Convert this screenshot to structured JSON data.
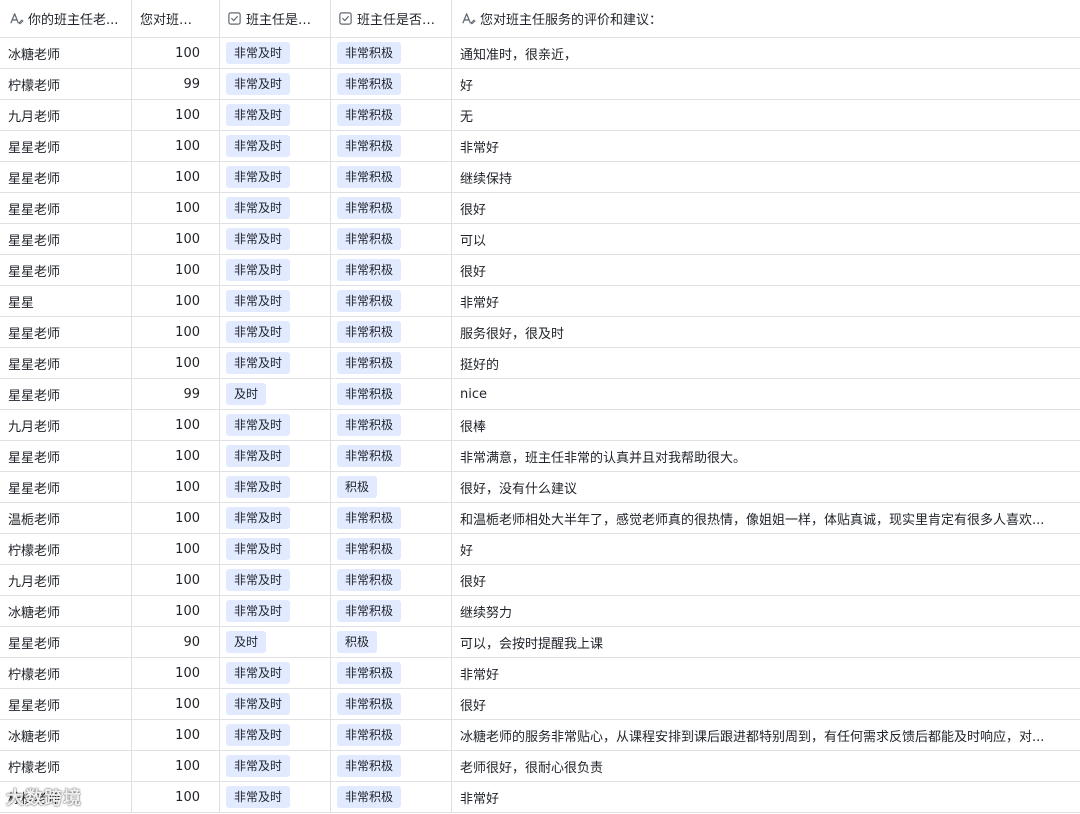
{
  "columns": [
    {
      "label": "你的班主任老...",
      "icon": "text-field-icon"
    },
    {
      "label": "您对班主...",
      "icon": ""
    },
    {
      "label": "班主任是否...",
      "icon": "select-field-icon"
    },
    {
      "label": "班主任是否积...",
      "icon": "select-field-icon"
    },
    {
      "label": "您对班主任服务的评价和建议：",
      "icon": "text-field-icon"
    }
  ],
  "rows": [
    {
      "teacher": "冰糖老师",
      "score": "100",
      "timely": "非常及时",
      "active": "非常积极",
      "comment": "通知准时，很亲近，"
    },
    {
      "teacher": "柠檬老师",
      "score": "99",
      "timely": "非常及时",
      "active": "非常积极",
      "comment": "好"
    },
    {
      "teacher": "九月老师",
      "score": "100",
      "timely": "非常及时",
      "active": "非常积极",
      "comment": "无"
    },
    {
      "teacher": "星星老师",
      "score": "100",
      "timely": "非常及时",
      "active": "非常积极",
      "comment": "非常好"
    },
    {
      "teacher": "星星老师",
      "score": "100",
      "timely": "非常及时",
      "active": "非常积极",
      "comment": "继续保持"
    },
    {
      "teacher": "星星老师",
      "score": "100",
      "timely": "非常及时",
      "active": "非常积极",
      "comment": "很好"
    },
    {
      "teacher": "星星老师",
      "score": "100",
      "timely": "非常及时",
      "active": "非常积极",
      "comment": "可以"
    },
    {
      "teacher": "星星老师",
      "score": "100",
      "timely": "非常及时",
      "active": "非常积极",
      "comment": "很好"
    },
    {
      "teacher": "星星",
      "score": "100",
      "timely": "非常及时",
      "active": "非常积极",
      "comment": "非常好"
    },
    {
      "teacher": "星星老师",
      "score": "100",
      "timely": "非常及时",
      "active": "非常积极",
      "comment": "服务很好，很及时"
    },
    {
      "teacher": "星星老师",
      "score": "100",
      "timely": "非常及时",
      "active": "非常积极",
      "comment": "挺好的"
    },
    {
      "teacher": "星星老师",
      "score": "99",
      "timely": "及时",
      "active": "非常积极",
      "comment": "nice"
    },
    {
      "teacher": "九月老师",
      "score": "100",
      "timely": "非常及时",
      "active": "非常积极",
      "comment": "很棒"
    },
    {
      "teacher": "星星老师",
      "score": "100",
      "timely": "非常及时",
      "active": "非常积极",
      "comment": "非常满意，班主任非常的认真并且对我帮助很大。"
    },
    {
      "teacher": "星星老师",
      "score": "100",
      "timely": "非常及时",
      "active": "积极",
      "comment": "很好，没有什么建议"
    },
    {
      "teacher": "温栀老师",
      "score": "100",
      "timely": "非常及时",
      "active": "非常积极",
      "comment": "和温栀老师相处大半年了，感觉老师真的很热情，像姐姐一样，体贴真诚，现实里肯定有很多人喜欢..."
    },
    {
      "teacher": "柠檬老师",
      "score": "100",
      "timely": "非常及时",
      "active": "非常积极",
      "comment": "好"
    },
    {
      "teacher": "九月老师",
      "score": "100",
      "timely": "非常及时",
      "active": "非常积极",
      "comment": "很好"
    },
    {
      "teacher": "冰糖老师",
      "score": "100",
      "timely": "非常及时",
      "active": "非常积极",
      "comment": "继续努力"
    },
    {
      "teacher": "星星老师",
      "score": "90",
      "timely": "及时",
      "active": "积极",
      "comment": "可以，会按时提醒我上课"
    },
    {
      "teacher": "柠檬老师",
      "score": "100",
      "timely": "非常及时",
      "active": "非常积极",
      "comment": "非常好"
    },
    {
      "teacher": "星星老师",
      "score": "100",
      "timely": "非常及时",
      "active": "非常积极",
      "comment": "很好"
    },
    {
      "teacher": "冰糖老师",
      "score": "100",
      "timely": "非常及时",
      "active": "非常积极",
      "comment": "冰糖老师的服务非常贴心，从课程安排到课后跟进都特别周到，有任何需求反馈后都能及时响应，对..."
    },
    {
      "teacher": "柠檬老师",
      "score": "100",
      "timely": "非常及时",
      "active": "非常积极",
      "comment": "老师很好，很耐心很负责"
    },
    {
      "teacher": "柠檬老师",
      "score": "100",
      "timely": "非常及时",
      "active": "非常积极",
      "comment": "非常好"
    }
  ],
  "colors": {
    "tag_bg": "#e1eaff",
    "border": "#dee0e3",
    "text": "#1f2329",
    "icon": "#646a73"
  },
  "watermark": "大数跨境"
}
